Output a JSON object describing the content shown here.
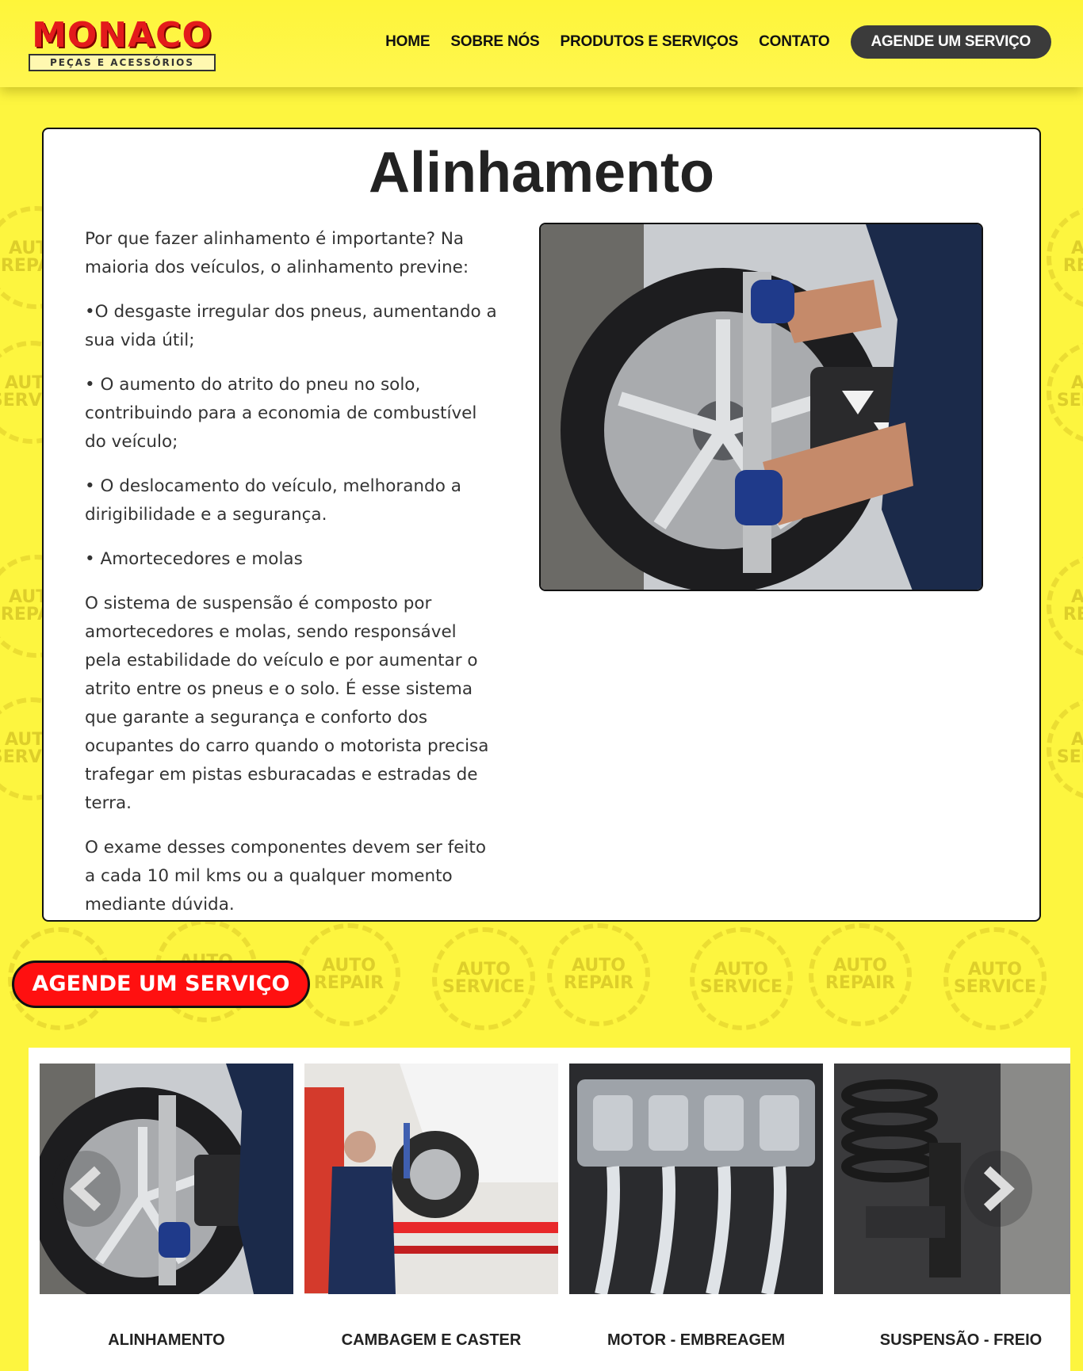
{
  "header": {
    "logo_text": "MONACO",
    "logo_subtitle": "PEÇAS E ACESSÓRIOS",
    "nav": [
      {
        "label": "HOME"
      },
      {
        "label": "SOBRE NÓS"
      },
      {
        "label": "PRODUTOS E SERVIÇOS"
      },
      {
        "label": "CONTATO"
      }
    ],
    "cta_label": "AGENDE UM SERVIÇO"
  },
  "main": {
    "title": "Alinhamento",
    "paragraphs": [
      "Por que fazer alinhamento é importante? Na maioria dos veículos, o alinhamento previne:",
      "•O desgaste irregular dos pneus, aumentando a sua vida útil;",
      "• O aumento do atrito do pneu no solo, contribuindo para a economia de combustível do veículo;",
      "• O deslocamento do veículo, melhorando a dirigibilidade e a segurança.",
      "• Amortecedores e molas",
      "O sistema de suspensão é composto por amortecedores e molas, sendo responsável pela estabilidade do veículo e por aumentar o atrito entre os pneus e o solo. É esse sistema que garante a segurança e conforto dos ocupantes do carro quando o motorista precisa trafegar em pistas esburacadas e estradas de terra.",
      "O exame desses componentes devem ser feito a cada 10 mil kms ou a qualquer momento mediante dúvida."
    ]
  },
  "cta_section": {
    "label": "AGENDE UM SERVIÇO"
  },
  "background": {
    "watermark_texts": [
      "AUTO REPAIR",
      "AUTO SERVICE"
    ]
  },
  "carousel": {
    "items": [
      {
        "caption": "ALINHAMENTO"
      },
      {
        "caption": "CAMBAGEM E CASTER"
      },
      {
        "caption": "MOTOR - EMBREAGEM"
      },
      {
        "caption": "SUSPENSÃO - FREIO"
      }
    ]
  },
  "colors": {
    "background": "#fdf53f",
    "accent_red": "#ff1010",
    "nav_cta_bg": "#3b3b3b"
  }
}
